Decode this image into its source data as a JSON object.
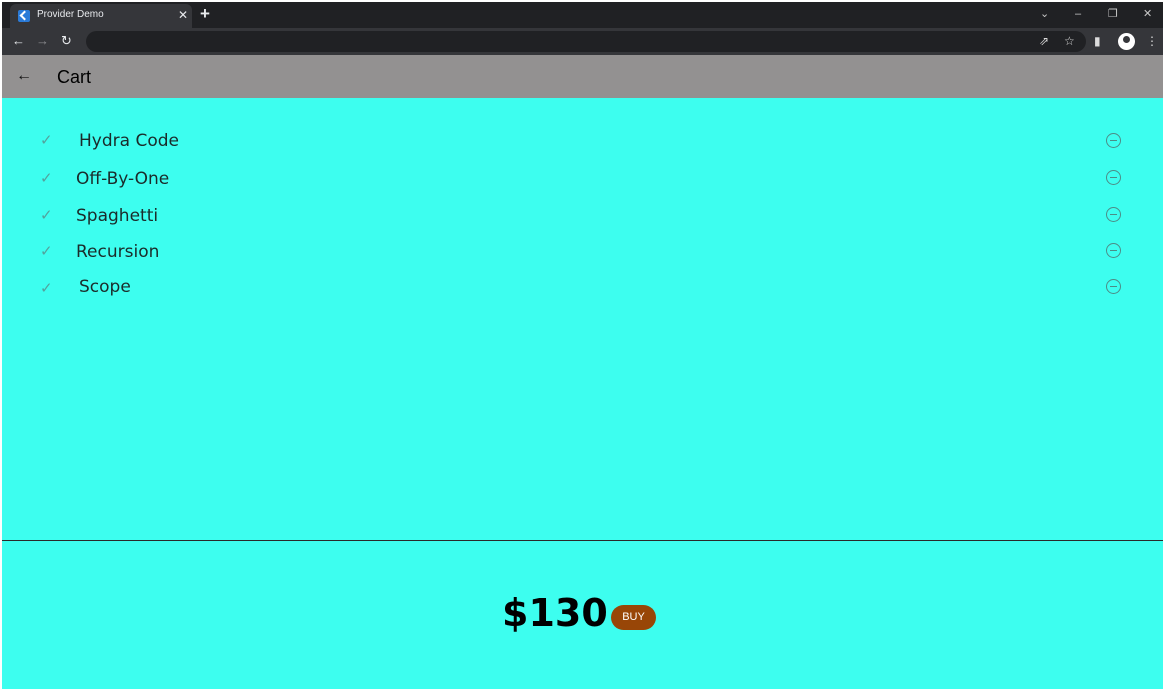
{
  "browser": {
    "tab_title": "Provider Demo",
    "tab_close": "✕",
    "new_tab": "+",
    "window_controls": {
      "dropdown": "⌄",
      "minimize": "–",
      "restore": "❐",
      "close": "✕"
    },
    "nav": {
      "back": "←",
      "forward": "→",
      "reload": "↻"
    },
    "toolbar_icons": {
      "share": "⇗",
      "bookmark": "☆",
      "side_panel": "▮",
      "menu": "⋮"
    }
  },
  "appbar": {
    "back": "←",
    "title": "Cart"
  },
  "cart": {
    "check_glyph": "✓",
    "items": [
      {
        "name": "Hydra Code"
      },
      {
        "name": "Off-By-One"
      },
      {
        "name": "Spaghetti"
      },
      {
        "name": "Recursion"
      },
      {
        "name": "Scope"
      }
    ],
    "total": "$130",
    "buy_label": "BUY"
  },
  "colors": {
    "background": "#3dfeef",
    "appbar": "#939191",
    "buy_button": "#984607"
  }
}
